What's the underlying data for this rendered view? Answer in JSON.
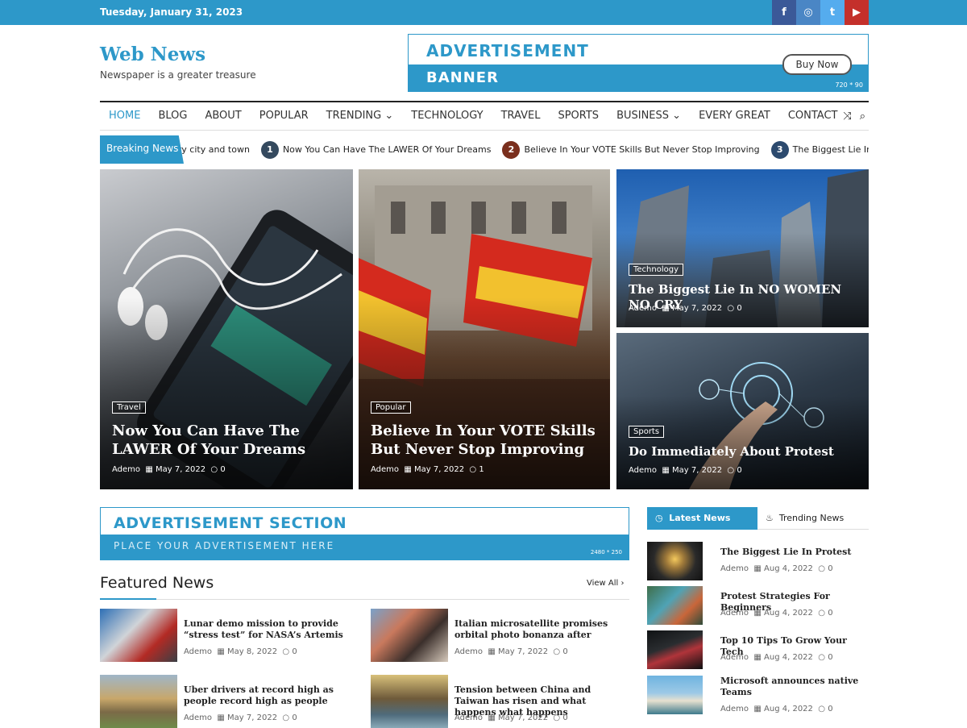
{
  "topbar": {
    "date": "Tuesday, January 31, 2023",
    "social": [
      {
        "icon": "facebook-icon",
        "glyph": "f",
        "color": "#3b5998"
      },
      {
        "icon": "instagram-icon",
        "glyph": "◎",
        "color": "#4a86c5"
      },
      {
        "icon": "twitter-icon",
        "glyph": "t",
        "color": "#55acee"
      },
      {
        "icon": "youtube-icon",
        "glyph": "▶",
        "color": "#c4302b"
      }
    ]
  },
  "brand": {
    "title": "Web News",
    "tagline": "Newspaper is a greater treasure"
  },
  "ad_banner": {
    "line1": "ADVERTISEMENT",
    "line2": "BANNER",
    "button": "Buy Now",
    "size": "720 * 90"
  },
  "nav": {
    "items": [
      "HOME",
      "BLOG",
      "ABOUT",
      "POPULAR",
      "TRENDING ⌄",
      "TECHNOLOGY",
      "TRAVEL",
      "SPORTS",
      "BUSINESS ⌄",
      "EVERY GREAT",
      "CONTACT"
    ],
    "shuffle_icon": "⤨",
    "search_icon": "⌕"
  },
  "ticker": {
    "label": "Breaking News",
    "items": [
      {
        "num": "",
        "text": "ery city and town"
      },
      {
        "num": "1",
        "text": "Now You Can Have The LAWER Of Your Dreams"
      },
      {
        "num": "2",
        "text": "Believe In Your VOTE Skills But Never Stop Improving"
      },
      {
        "num": "3",
        "text": "The Biggest Lie In NO WOMEN NO CRY"
      }
    ]
  },
  "hero": [
    {
      "category": "Travel",
      "title": "Now You Can Have The LAWER Of Your Dreams",
      "author": "Ademo",
      "date": "May 7, 2022",
      "comments": "0"
    },
    {
      "category": "Popular",
      "title": "Believe In Your VOTE Skills But Never Stop Improving",
      "author": "Ademo",
      "date": "May 7, 2022",
      "comments": "1"
    },
    {
      "category": "Technology",
      "title": "The Biggest Lie In NO WOMEN NO CRY",
      "author": "Ademo",
      "date": "May 7, 2022",
      "comments": "0"
    },
    {
      "category": "Sports",
      "title": "Do Immediately About Protest",
      "author": "Ademo",
      "date": "May 7, 2022",
      "comments": "0"
    }
  ],
  "ad_section": {
    "line1": "ADVERTISEMENT SECTION",
    "line2": "PLACE YOUR ADVERTISEMENT HERE",
    "size": "2480 * 250"
  },
  "featured": {
    "heading": "Featured News",
    "view_all": "View All ›",
    "items": [
      {
        "title": "Lunar demo mission to provide “stress test” for NASA’s Artemis",
        "author": "Ademo",
        "date": "May 8, 2022",
        "comments": "0"
      },
      {
        "title": "Italian microsatellite promises orbital photo bonanza after",
        "author": "Ademo",
        "date": "May 7, 2022",
        "comments": "0"
      },
      {
        "title": "Uber drivers at record high as people record high as people",
        "author": "Ademo",
        "date": "May 7, 2022",
        "comments": "0"
      },
      {
        "title": "Tension between China and Taiwan has risen and what happens what happens",
        "author": "Ademo",
        "date": "May 7, 2022",
        "comments": "0"
      }
    ]
  },
  "sidebar": {
    "tab_latest": "Latest News",
    "tab_trending": "Trending News",
    "items": [
      {
        "title": "The Biggest Lie In Protest",
        "author": "Ademo",
        "date": "Aug 4, 2022",
        "comments": "0"
      },
      {
        "title": "Protest Strategies For Beginners",
        "author": "Ademo",
        "date": "Aug 4, 2022",
        "comments": "0"
      },
      {
        "title": "Top 10 Tips To Grow Your Tech",
        "author": "Ademo",
        "date": "Aug 4, 2022",
        "comments": "0"
      },
      {
        "title": "Microsoft announces native Teams",
        "author": "Ademo",
        "date": "Aug 4, 2022",
        "comments": "0"
      }
    ]
  },
  "colors": {
    "accent": "#2d98c9",
    "dark": "#222222"
  }
}
